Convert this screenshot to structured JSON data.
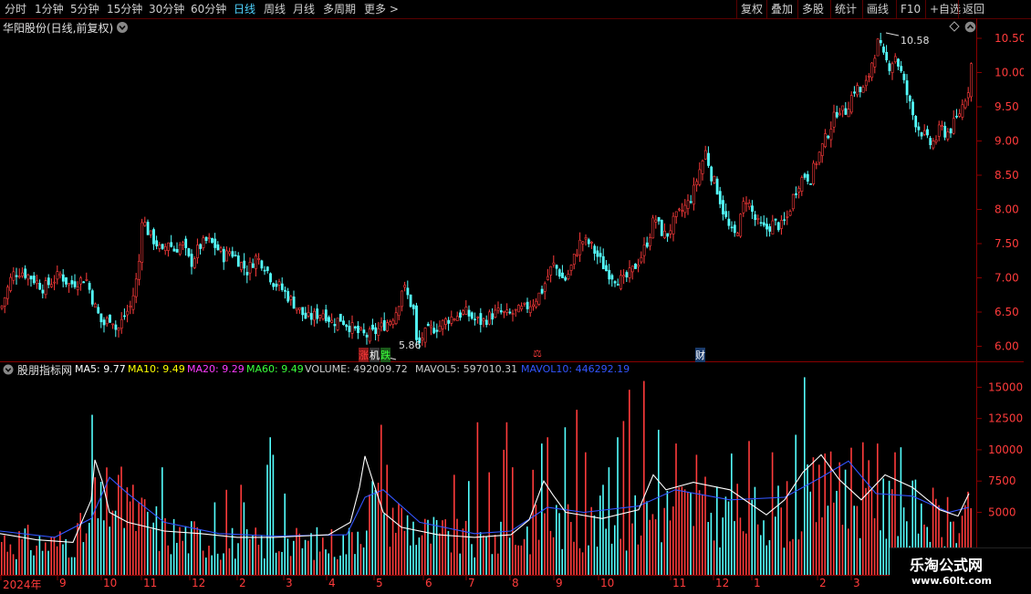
{
  "toolbar": {
    "periods": [
      "分时",
      "1分钟",
      "5分钟",
      "15分钟",
      "30分钟",
      "60分钟",
      "日线",
      "周线",
      "月线",
      "多周期",
      "更多 >"
    ],
    "active": "日线",
    "right_buttons": [
      "复权",
      "叠加",
      "多股",
      "统计",
      "画线",
      "F10",
      "+自选",
      "返回"
    ]
  },
  "price_panel": {
    "title": "华阳股份(日线,前复权)",
    "max_label": "10.58",
    "min_label": "5.86",
    "markers": [
      {
        "text": "涨",
        "color": "#ff3b3b"
      },
      {
        "text": "机",
        "color": "#ffffff"
      },
      {
        "text": "跌",
        "color": "#3bff3b"
      },
      {
        "text": "⚖",
        "color": "#ff3b3b"
      },
      {
        "text": "财",
        "color": "#ffffff"
      }
    ]
  },
  "indicator_panel": {
    "name": "股朋指标网",
    "items": [
      {
        "label": "MA5: 9.77",
        "color": "#ffffff"
      },
      {
        "label": "MA10: 9.49",
        "color": "#ffff00"
      },
      {
        "label": "MA20: 9.29",
        "color": "#ff3bff"
      },
      {
        "label": "MA60: 9.49",
        "color": "#3bff3b"
      },
      {
        "label": "VOLUME: 492009.72",
        "color": "#cccccc"
      },
      {
        "label": "MAVOL5: 597010.31",
        "color": "#cccccc"
      },
      {
        "label": "MAVOL10: 446292.19",
        "color": "#3355ff"
      }
    ]
  },
  "x_axis": [
    "2024年",
    "9",
    "10",
    "11",
    "12",
    "2",
    "3",
    "4",
    "5",
    "6",
    "7",
    "8",
    "9",
    "10",
    "11",
    "12",
    "1",
    "2",
    "3"
  ],
  "watermark": {
    "title": "乐淘公式网",
    "url": "www.60lt.com"
  },
  "chart_data": [
    {
      "type": "candlestick",
      "title": "华阳股份(日线,前复权)",
      "y_ticks": [
        6.0,
        6.5,
        7.0,
        7.5,
        8.0,
        8.5,
        9.0,
        9.5,
        10.0,
        10.5
      ],
      "ylim": [
        5.78,
        10.78
      ],
      "colors": {
        "up": "#ff3b3b",
        "down": "#54ffff"
      },
      "close_path": [
        [
          0,
          6.55
        ],
        [
          8,
          7.05
        ],
        [
          14,
          7.1
        ],
        [
          22,
          7.0
        ],
        [
          30,
          6.85
        ],
        [
          36,
          6.95
        ],
        [
          42,
          7.05
        ],
        [
          48,
          6.9
        ],
        [
          54,
          6.95
        ],
        [
          60,
          7.0
        ],
        [
          66,
          6.6
        ],
        [
          72,
          6.3
        ],
        [
          78,
          6.45
        ],
        [
          82,
          6.2
        ],
        [
          86,
          6.4
        ],
        [
          92,
          6.6
        ],
        [
          96,
          7.0
        ],
        [
          98,
          7.3
        ],
        [
          100,
          8.0
        ],
        [
          102,
          7.75
        ],
        [
          106,
          7.6
        ],
        [
          110,
          7.5
        ],
        [
          114,
          7.35
        ],
        [
          118,
          7.55
        ],
        [
          122,
          7.4
        ],
        [
          128,
          7.5
        ],
        [
          134,
          7.2
        ],
        [
          140,
          7.45
        ],
        [
          146,
          7.55
        ],
        [
          152,
          7.45
        ],
        [
          158,
          7.3
        ],
        [
          162,
          7.4
        ],
        [
          168,
          7.25
        ],
        [
          174,
          7.1
        ],
        [
          180,
          7.3
        ],
        [
          186,
          7.2
        ],
        [
          192,
          6.95
        ],
        [
          198,
          6.85
        ],
        [
          204,
          6.7
        ],
        [
          210,
          6.55
        ],
        [
          216,
          6.4
        ],
        [
          222,
          6.45
        ],
        [
          228,
          6.5
        ],
        [
          234,
          6.35
        ],
        [
          240,
          6.4
        ],
        [
          246,
          6.3
        ],
        [
          252,
          6.2
        ],
        [
          258,
          6.15
        ],
        [
          264,
          6.2
        ],
        [
          270,
          6.3
        ],
        [
          276,
          6.4
        ],
        [
          280,
          6.55
        ],
        [
          284,
          6.9
        ],
        [
          288,
          6.7
        ],
        [
          292,
          6.5
        ],
        [
          294,
          5.95
        ],
        [
          298,
          6.15
        ],
        [
          304,
          6.25
        ],
        [
          310,
          6.3
        ],
        [
          316,
          6.4
        ],
        [
          322,
          6.45
        ],
        [
          328,
          6.5
        ],
        [
          334,
          6.4
        ],
        [
          340,
          6.35
        ],
        [
          346,
          6.45
        ],
        [
          352,
          6.5
        ],
        [
          358,
          6.45
        ],
        [
          364,
          6.5
        ],
        [
          370,
          6.55
        ],
        [
          376,
          6.65
        ],
        [
          382,
          6.8
        ],
        [
          386,
          7.0
        ],
        [
          390,
          7.2
        ],
        [
          394,
          7.1
        ],
        [
          398,
          6.95
        ],
        [
          402,
          7.1
        ],
        [
          406,
          7.35
        ],
        [
          410,
          7.55
        ],
        [
          416,
          7.5
        ],
        [
          422,
          7.3
        ],
        [
          428,
          7.1
        ],
        [
          434,
          7.0
        ],
        [
          440,
          6.95
        ],
        [
          446,
          7.1
        ],
        [
          452,
          7.3
        ],
        [
          458,
          7.6
        ],
        [
          462,
          7.9
        ],
        [
          466,
          7.7
        ],
        [
          470,
          7.6
        ],
        [
          476,
          7.85
        ],
        [
          482,
          8.0
        ],
        [
          486,
          8.1
        ],
        [
          490,
          8.3
        ],
        [
          494,
          8.6
        ],
        [
          498,
          8.85
        ],
        [
          502,
          8.5
        ],
        [
          506,
          8.3
        ],
        [
          510,
          8.0
        ],
        [
          514,
          7.75
        ],
        [
          518,
          7.6
        ],
        [
          522,
          7.8
        ],
        [
          526,
          8.2
        ],
        [
          530,
          8.0
        ],
        [
          534,
          7.8
        ],
        [
          540,
          7.7
        ],
        [
          546,
          7.8
        ],
        [
          552,
          7.75
        ],
        [
          556,
          7.9
        ],
        [
          560,
          8.2
        ],
        [
          564,
          8.4
        ],
        [
          568,
          8.5
        ],
        [
          572,
          8.45
        ],
        [
          576,
          8.7
        ],
        [
          580,
          8.9
        ],
        [
          584,
          9.1
        ],
        [
          588,
          9.3
        ],
        [
          592,
          9.5
        ],
        [
          596,
          9.4
        ],
        [
          600,
          9.6
        ],
        [
          604,
          9.8
        ],
        [
          608,
          9.7
        ],
        [
          612,
          9.85
        ],
        [
          616,
          10.2
        ],
        [
          620,
          10.45
        ],
        [
          624,
          10.2
        ],
        [
          628,
          10.1
        ],
        [
          632,
          10.25
        ],
        [
          636,
          10.0
        ],
        [
          640,
          9.7
        ],
        [
          644,
          9.4
        ],
        [
          648,
          9.2
        ],
        [
          652,
          9.1
        ],
        [
          656,
          8.95
        ],
        [
          660,
          9.0
        ],
        [
          664,
          9.2
        ],
        [
          668,
          9.1
        ],
        [
          672,
          9.2
        ],
        [
          676,
          9.35
        ],
        [
          680,
          9.55
        ],
        [
          684,
          9.8
        ],
        [
          686,
          10.2
        ]
      ]
    },
    {
      "type": "bar",
      "series": [
        {
          "name": "VOLUME"
        },
        {
          "name": "MAVOL5"
        },
        {
          "name": "MAVOL10"
        }
      ],
      "y_ticks": [
        5000,
        7500,
        10000,
        12500,
        15000
      ],
      "ylim": [
        0,
        17000
      ],
      "colors": {
        "up": "#ff3b3b",
        "down": "#54ffff",
        "mavol5": "#ffffff",
        "mavol10": "#3355ff"
      },
      "spikes": [
        [
          100,
          12800
        ],
        [
          102,
          9000
        ],
        [
          104,
          7800
        ],
        [
          140,
          7000
        ],
        [
          176,
          8600
        ],
        [
          236,
          5800
        ],
        [
          248,
          6800
        ],
        [
          262,
          7200
        ],
        [
          268,
          5800
        ],
        [
          292,
          8800
        ],
        [
          294,
          15600
        ],
        [
          296,
          11000
        ],
        [
          300,
          9600
        ],
        [
          312,
          6500
        ],
        [
          408,
          7500
        ],
        [
          418,
          12000
        ],
        [
          422,
          8800
        ],
        [
          496,
          8000
        ],
        [
          514,
          7500
        ],
        [
          524,
          12200
        ],
        [
          536,
          8200
        ],
        [
          550,
          10000
        ],
        [
          554,
          12200
        ],
        [
          560,
          8600
        ],
        [
          582,
          8400
        ],
        [
          594,
          10500
        ],
        [
          600,
          11000
        ],
        [
          620,
          11800
        ],
        [
          630,
          13200
        ],
        [
          642,
          9800
        ],
        [
          660,
          7200
        ],
        [
          666,
          8600
        ],
        [
          676,
          11000
        ],
        [
          684,
          12300
        ],
        [
          690,
          14800
        ],
        [
          704,
          15500
        ],
        [
          720,
          11600
        ],
        [
          740,
          10500
        ],
        [
          764,
          9600
        ],
        [
          800,
          9700
        ],
        [
          820,
          10700
        ],
        [
          846,
          9800
        ],
        [
          870,
          11200
        ],
        [
          882,
          15800
        ],
        [
          890,
          9400
        ],
        [
          902,
          9700
        ],
        [
          920,
          9000
        ],
        [
          946,
          10600
        ],
        [
          960,
          10500
        ],
        [
          980,
          9800
        ],
        [
          986,
          10200
        ]
      ],
      "mavol5_path": [
        [
          0,
          3300
        ],
        [
          40,
          2800
        ],
        [
          80,
          2600
        ],
        [
          100,
          6000
        ],
        [
          104,
          9200
        ],
        [
          112,
          7500
        ],
        [
          120,
          5000
        ],
        [
          140,
          4200
        ],
        [
          180,
          3500
        ],
        [
          220,
          3300
        ],
        [
          260,
          3000
        ],
        [
          300,
          3000
        ],
        [
          330,
          3100
        ],
        [
          360,
          3200
        ],
        [
          384,
          4200
        ],
        [
          394,
          7000
        ],
        [
          400,
          9500
        ],
        [
          410,
          7200
        ],
        [
          420,
          5000
        ],
        [
          440,
          3800
        ],
        [
          480,
          3200
        ],
        [
          520,
          3000
        ],
        [
          560,
          3200
        ],
        [
          580,
          4400
        ],
        [
          596,
          7500
        ],
        [
          606,
          6400
        ],
        [
          620,
          5000
        ],
        [
          660,
          4500
        ],
        [
          700,
          5200
        ],
        [
          716,
          8000
        ],
        [
          730,
          6800
        ],
        [
          760,
          7400
        ],
        [
          800,
          6800
        ],
        [
          840,
          4800
        ],
        [
          860,
          6000
        ],
        [
          880,
          8200
        ],
        [
          900,
          9600
        ],
        [
          920,
          7600
        ],
        [
          944,
          6000
        ],
        [
          970,
          8000
        ],
        [
          1000,
          7000
        ],
        [
          1030,
          5200
        ],
        [
          1050,
          4700
        ],
        [
          1062,
          6500
        ]
      ],
      "mavol10_path": [
        [
          0,
          3500
        ],
        [
          60,
          3000
        ],
        [
          100,
          4500
        ],
        [
          120,
          7800
        ],
        [
          140,
          6500
        ],
        [
          180,
          4200
        ],
        [
          240,
          3300
        ],
        [
          300,
          3100
        ],
        [
          380,
          3200
        ],
        [
          400,
          6200
        ],
        [
          420,
          6800
        ],
        [
          460,
          4200
        ],
        [
          520,
          3300
        ],
        [
          560,
          3500
        ],
        [
          600,
          5400
        ],
        [
          640,
          5000
        ],
        [
          700,
          5500
        ],
        [
          740,
          6800
        ],
        [
          800,
          6000
        ],
        [
          860,
          6200
        ],
        [
          900,
          7800
        ],
        [
          930,
          9100
        ],
        [
          960,
          6500
        ],
        [
          1000,
          6300
        ],
        [
          1040,
          5000
        ],
        [
          1062,
          5400
        ]
      ]
    }
  ]
}
